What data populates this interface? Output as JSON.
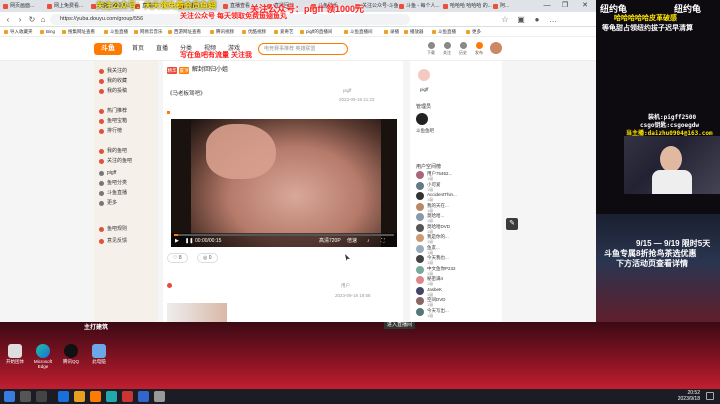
{
  "browser": {
    "tabs": [
      "网页画面...",
      "网上免费看...",
      "斗鱼 - 每个人...",
      "直播间",
      "斗鱼",
      "直播查看",
      "直播回放",
      "斗鱼助手",
      "关注公众号-斗鱼",
      "斗鱼 - 每个人...",
      "哈哈哈 哈哈哈 的...",
      "阿..."
    ],
    "address": "https://yuba.douyu.com/group/556",
    "favorites": [
      "导入收藏夹",
      "Bing",
      "搜集网址查看",
      "斗鱼直播",
      "网易云音乐",
      "西游网址查看",
      "腾讯视频",
      "优酷视频",
      "爱奇艺",
      "pigff的直播间",
      "斗鱼直播间",
      "录播",
      "播放器",
      "斗鱼直播",
      "更多"
    ],
    "window_controls": [
      "—",
      "❐",
      "✕"
    ]
  },
  "site": {
    "logo": "斗鱼",
    "nav": [
      "首页",
      "直播",
      "分类",
      "视频",
      "游戏",
      "鱼吧"
    ],
    "search_placeholder": "电竞赛事推荐  英雄联盟",
    "header_icons": [
      "下载",
      "关注",
      "历史",
      "发布"
    ]
  },
  "sidebar": {
    "items": [
      "我关注的",
      "我的收藏",
      "我的投稿",
      "热门推荐",
      "鱼吧宝箱",
      "排行榜",
      "我的鱼吧",
      "关注的鱼吧",
      "pigff",
      "鱼吧分类",
      "斗鱼直播",
      "更多",
      "鱼吧规则",
      "意见反馈"
    ]
  },
  "post": {
    "tags": [
      "精华",
      "置顶"
    ],
    "title": "解封回归小姐",
    "author": "pigff",
    "time": "2023-09-18 21:23",
    "content": "《马老板驾吧》",
    "video": {
      "timecode": "00:00/00:15",
      "quality": "高清720P",
      "speed": "倍速",
      "progress_fraction": 0.02
    },
    "likes": "8",
    "comments": "0",
    "footer_time": "2023-09-18 19:58",
    "reply_label": "用户"
  },
  "rightcol": {
    "profile_name": "pigff",
    "admin_title": "管理员",
    "admin_name": "斗鱼鱼吧",
    "list_title": "用户空间榜",
    "members": [
      {
        "name": "用户75462...",
        "sub": "1级"
      },
      {
        "name": "小可爱",
        "sub": "1级"
      },
      {
        "name": "AccidentThin...",
        "sub": "1级"
      },
      {
        "name": "我的天在...",
        "sub": "1级"
      },
      {
        "name": "莫哈哈...",
        "sub": "1级"
      },
      {
        "name": "莫哈哈DVD",
        "sub": "1级"
      },
      {
        "name": "我是你的...",
        "sub": "1级"
      },
      {
        "name": "鱼友...",
        "sub": "1级"
      },
      {
        "name": "今天我也...",
        "sub": "1级"
      },
      {
        "name": "中文鱼你P232",
        "sub": "1级"
      },
      {
        "name": "秘密满4",
        "sub": "1级"
      },
      {
        "name": "JasbeK",
        "sub": "1级"
      },
      {
        "name": "空间DVD",
        "sub": "1级"
      },
      {
        "name": "今天写出...",
        "sub": "1级"
      }
    ]
  },
  "overlays": {
    "banner_yellow": "关注公众号：天天领免费会员鱼翅",
    "banner_red": "关注公众号 每天领取免费鱼翅鱼丸",
    "banner_red2": "写在鱼吧有流量  关注我",
    "banner_pigff": "关注公众号：pigff  领1000元",
    "right_title1": "纽约龟",
    "right_title2": "纽约龟",
    "right_line1": "哈哈哈哈哈皮革破感",
    "right_line2": "等龟甜占领纽约拔子迟早清算",
    "right_info1": "装机:pigff2500",
    "right_info2": "csgo钥匙:csgoegdw",
    "right_info3": "当主播:daizhu0904@163.com",
    "right_event1": "9/15 — 9/19 限时5天",
    "right_event2": "斗鱼专属8折抢鸟茶选优惠",
    "right_event3": "下方活动页查看详情"
  },
  "desktop": {
    "icons": [
      "开始团体",
      "Microsoft Edge",
      "腾讯QQ",
      "此电脑"
    ],
    "stream_label": "主打建筑",
    "right_btn": "进入直播间"
  },
  "taskbar": {
    "time": "20:52",
    "date": "2023/9/18"
  },
  "colors": {
    "accent": "#ff7a00",
    "overlay_yellow": "#ffe600",
    "overlay_red": "#ff2020"
  }
}
